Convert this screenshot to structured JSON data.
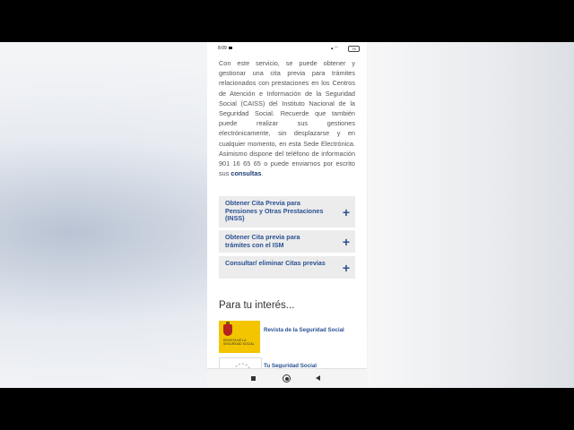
{
  "status": {
    "time": "8:09",
    "battery": "79"
  },
  "intro": {
    "text": "Con este servicio, se puede obtener y gestionar una cita previa para trámites relacionados con prestaciones en los Centros de Atención e Información de la Seguridad Social (CAISS) del Instituto Nacional de la Seguridad Social. Recuerde que también puede realizar sus gestiones electrónicamente, sin desplazarse y en cualquier momento, en esta Sede Electrónica. Asimismo dispone del teléfono de información 901 16 65 65 o puede enviarnos por escrito sus ",
    "link": "consultas",
    "end": "."
  },
  "accordion": [
    {
      "label": "Obtener Cita Previa para Pensiones y Otras Prestaciones (INSS)",
      "icon": "+"
    },
    {
      "label": "Obtener Cita previa para trámites con el ISM",
      "icon": "+"
    },
    {
      "label": "Consultar/ eliminar Citas previas",
      "icon": "+"
    }
  ],
  "interest": {
    "heading": "Para tu interés...",
    "links": [
      {
        "label": "Revista de la Seguridad Social",
        "logo_text": "REVISTA DE LA SEGURIDAD SOCIAL"
      },
      {
        "label": "Tu Seguridad Social"
      }
    ]
  },
  "colors": {
    "link": "#2a5192",
    "accordion_bg": "#ececec",
    "logo_yellow": "#f2c500"
  }
}
